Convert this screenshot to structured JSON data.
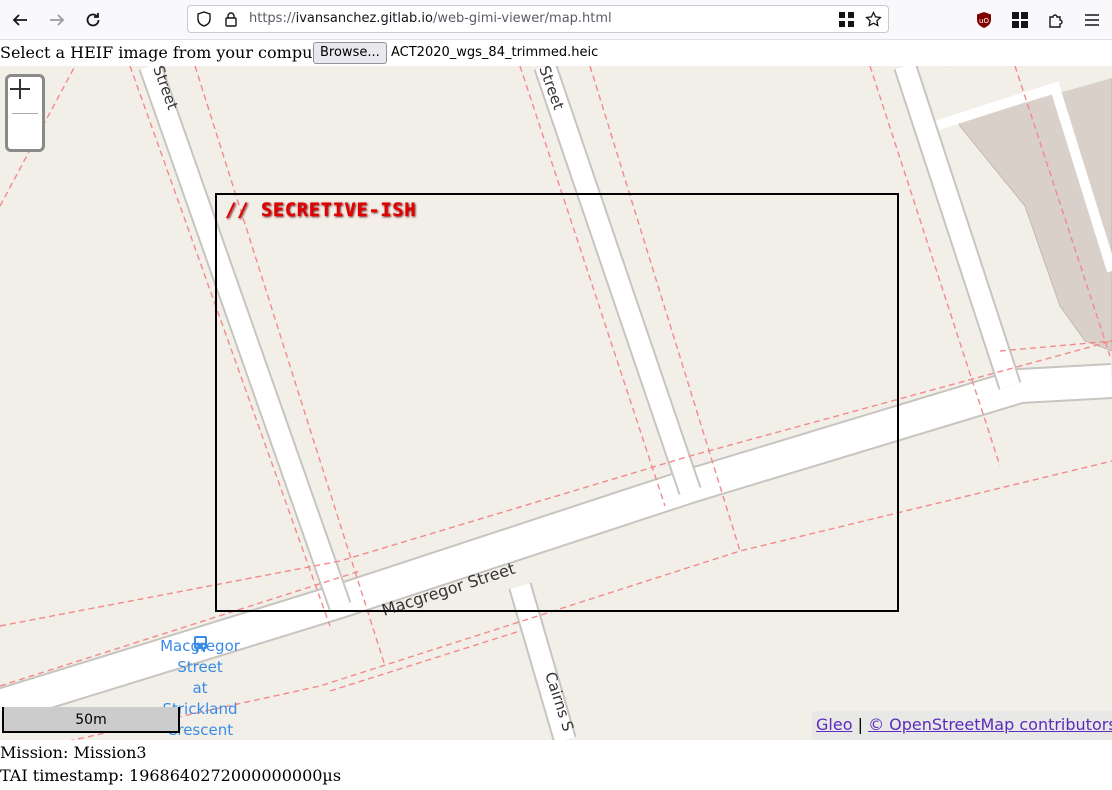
{
  "browser": {
    "url_scheme": "https://",
    "url_host": "ivansanchez.gitlab.io",
    "url_path": "/web-gimi-viewer/map.html"
  },
  "picker": {
    "label": "Select a HEIF image from your computer:",
    "browse_label": "Browse...",
    "file_name": "ACT2020_wgs_84_trimmed.heic"
  },
  "map": {
    "overlay_label": "// SECRETIVE-ISH",
    "street_labels": [
      "Street",
      "Street",
      "Macgregor Street",
      "Cairns S"
    ],
    "bus_stop_lines": [
      "Macgregor",
      "Street",
      "at Strickland",
      "Crescent"
    ],
    "scale_label": "50m",
    "attribution": {
      "gleo": "Gleo",
      "separator": "|",
      "osm": "© OpenStreetMap contributors"
    },
    "zoom": {
      "in": "+",
      "out": "−"
    }
  },
  "info": {
    "mission": "Mission: Mission3",
    "tai": "TAI timestamp: 1968640272000000000µs"
  },
  "colors": {
    "map_bg": "#f2efe9",
    "road": "#ffffff",
    "boundary": "#f28a8a",
    "label_red": "#e00000",
    "link": "#5b2bbd",
    "bus": "#3a8be8"
  }
}
